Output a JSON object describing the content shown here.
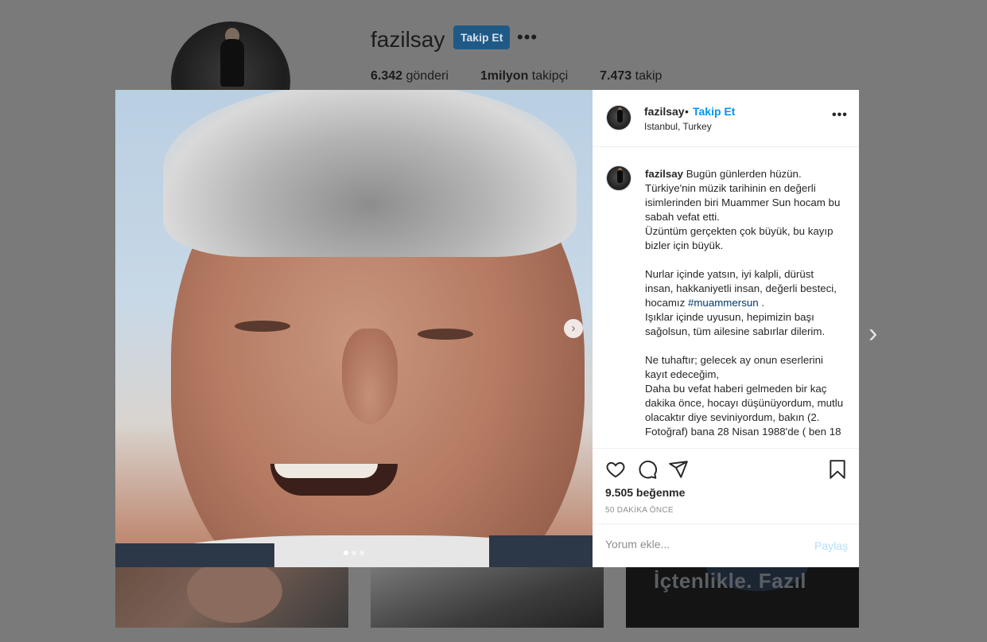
{
  "profile": {
    "username": "fazilsay",
    "follow_label": "Takip Et",
    "more_label": "•••",
    "stats": [
      {
        "value": "6.342",
        "label": "gönderi"
      },
      {
        "value": "1milyon",
        "label": "takipçi"
      },
      {
        "value": "7.473",
        "label": "takip"
      }
    ]
  },
  "grid": {
    "thumb3_text": "İçtenlikle. Fazıl"
  },
  "carousel": {
    "next_outer": "›",
    "next_inner": "›",
    "slide_count": 3,
    "active_slide": 1
  },
  "post": {
    "header": {
      "username": "fazilsay",
      "separator": "•",
      "follow_label": "Takip Et",
      "location": "Istanbul, Turkey",
      "more_label": "•••"
    },
    "caption": {
      "username": "fazilsay",
      "text_1": " Bugün günlerden hüzün.\nTürkiye'nin müzik tarihinin en değerli isimlerinden biri Muammer Sun hocam bu sabah vefat etti.\nÜzüntüm gerçekten çok büyük, bu kayıp bizler için büyük.\n\nNurlar içinde yatsın, iyi kalpli, dürüst insan, hakkaniyetli insan, değerli besteci, hocamız ",
      "hashtag": "#muammersun",
      "text_2": " .\nIşıklar içinde uyusun, hepimizin başı sağolsun, tüm ailesine sabırlar dilerim.\n\nNe tuhaftır; gelecek ay onun eserlerini kayıt edeceğim,\nDaha bu vefat haberi gelmeden bir kaç dakika önce, hocayı düşünüyordum, mutlu olacaktır diye seviniyordum, bakın (2. Fotoğraf) bana 28 Nisan 1988'de ( ben 18"
    },
    "likes": "9.505 beğenme",
    "time": "50 DAKİKA ÖNCE",
    "comment": {
      "placeholder": "Yorum ekle...",
      "post_label": "Paylaş"
    }
  }
}
